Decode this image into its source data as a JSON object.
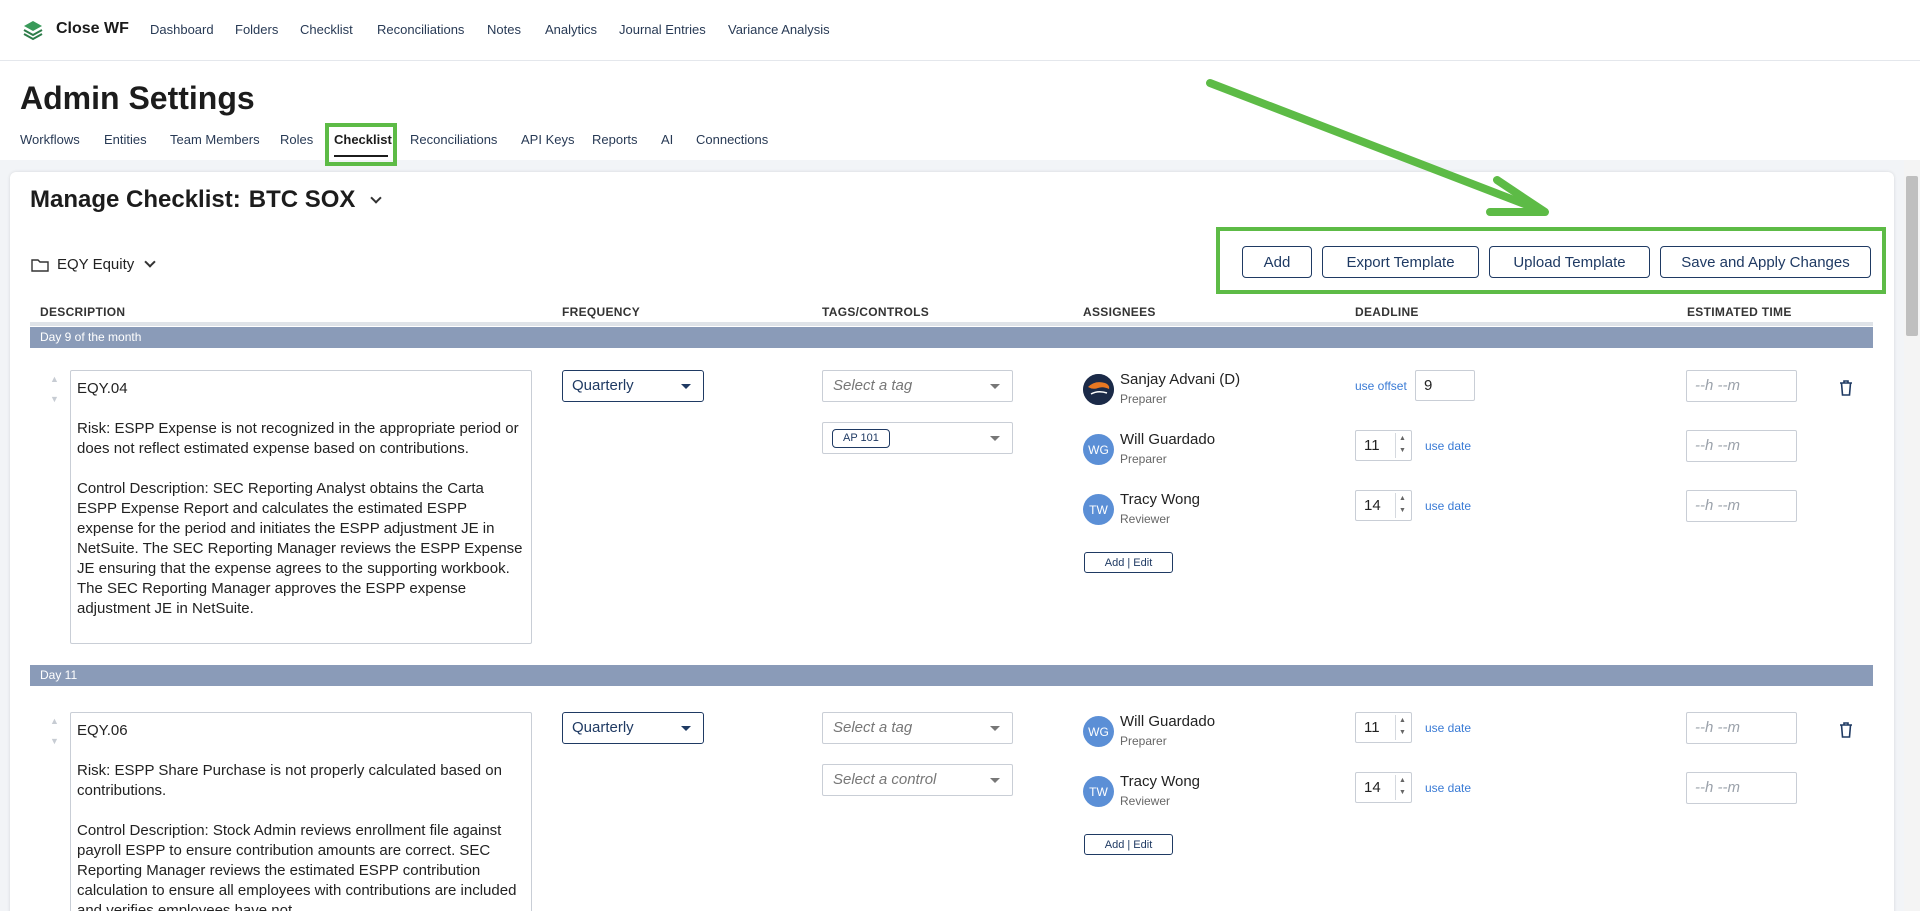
{
  "app": {
    "brand": "Close WF",
    "nav": [
      "Dashboard",
      "Folders",
      "Checklist",
      "Reconciliations",
      "Notes",
      "Analytics",
      "Journal Entries",
      "Variance Analysis"
    ]
  },
  "page": {
    "title": "Admin Settings",
    "tabs": [
      "Workflows",
      "Entities",
      "Team Members",
      "Roles",
      "Checklist",
      "Reconciliations",
      "API Keys",
      "Reports",
      "AI",
      "Connections"
    ],
    "active_tab": "Checklist"
  },
  "manage": {
    "label": "Manage Checklist:",
    "checklist_name": "BTC SOX",
    "folder": "EQY Equity"
  },
  "toolbar": {
    "add": "Add",
    "export": "Export Template",
    "upload": "Upload Template",
    "save": "Save and Apply Changes"
  },
  "columns": {
    "description": "DESCRIPTION",
    "frequency": "FREQUENCY",
    "tags": "TAGS/CONTROLS",
    "assignees": "ASSIGNEES",
    "deadline": "DEADLINE",
    "time": "ESTIMATED TIME"
  },
  "groups": [
    {
      "label": "Day 9 of the month",
      "item": {
        "code": "EQY.04",
        "risk": "Risk: ESPP Expense is not recognized in the appropriate period or does not reflect estimated expense based on contributions.",
        "control": "Control Description: SEC Reporting Analyst obtains the Carta ESPP Expense Report and calculates the estimated ESPP expense for the period and initiates the ESPP adjustment JE in NetSuite. The SEC Reporting Manager reviews the ESPP Expense JE ensuring that the expense agrees to the supporting workbook. The SEC Reporting Manager approves the ESPP expense adjustment JE in NetSuite.",
        "frequency": "Quarterly",
        "tag_placeholder": "Select a tag",
        "control_chip": "AP 101",
        "assignees": [
          {
            "initials": "",
            "name": "Sanjay Advani (D)",
            "role": "Preparer",
            "deadline": "9",
            "deadline_mode": "use offset"
          },
          {
            "initials": "WG",
            "name": "Will Guardado",
            "role": "Preparer",
            "deadline": "11",
            "deadline_mode": "use date"
          },
          {
            "initials": "TW",
            "name": "Tracy Wong",
            "role": "Reviewer",
            "deadline": "14",
            "deadline_mode": "use date"
          }
        ],
        "add_edit": "Add | Edit",
        "time_placeholder": "--h --m"
      }
    },
    {
      "label": "Day 11",
      "item": {
        "code": "EQY.06",
        "risk": "Risk: ESPP Share Purchase is not properly calculated based on contributions.",
        "control": "Control Description: Stock Admin reviews enrollment file against payroll ESPP to ensure contribution amounts are correct. SEC Reporting Manager reviews the estimated ESPP contribution calculation to ensure all employees with contributions are included and verifies employees have not",
        "frequency": "Quarterly",
        "tag_placeholder": "Select a tag",
        "control_placeholder": "Select a control",
        "assignees": [
          {
            "initials": "WG",
            "name": "Will Guardado",
            "role": "Preparer",
            "deadline": "11",
            "deadline_mode": "use date"
          },
          {
            "initials": "TW",
            "name": "Tracy Wong",
            "role": "Reviewer",
            "deadline": "14",
            "deadline_mode": "use date"
          }
        ],
        "add_edit": "Add | Edit",
        "time_placeholder": "--h --m"
      }
    }
  ],
  "colors": {
    "accent": "#1f3a63",
    "group_bar": "#8a9bb8",
    "highlight": "#5dbb46",
    "link": "#3a7bd5"
  }
}
